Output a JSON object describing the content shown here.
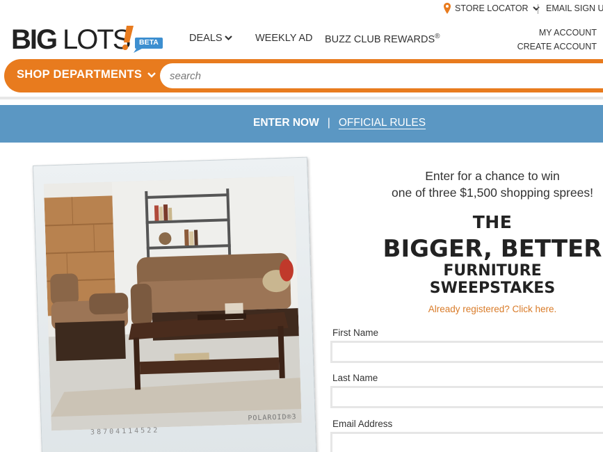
{
  "utility": {
    "store_locator": "STORE LOCATOR",
    "email_signup": "EMAIL SIGN UP"
  },
  "brand": {
    "logo_text": "BIGLOTS!",
    "beta_badge": "BETA",
    "colors": {
      "orange": "#e87b1e",
      "blue": "#5b97c3",
      "text": "#333333",
      "link_orange": "#d97b28"
    }
  },
  "nav": {
    "deals": "DEALS",
    "weekly_ad": "WEEKLY AD",
    "buzz_club": "BUZZ CLUB REWARDS",
    "buzz_reg": "®"
  },
  "account": {
    "my_account": "MY ACCOUNT",
    "create_account": "CREATE ACCOUNT"
  },
  "shop": {
    "departments_label": "SHOP DEPARTMENTS",
    "search_placeholder": "search"
  },
  "band": {
    "enter_now": "ENTER NOW",
    "separator": "|",
    "official_rules": "OFFICIAL RULES"
  },
  "photo": {
    "polaroid_label": "POLAROID®3",
    "polaroid_number": "38704114522"
  },
  "promo": {
    "line1": "Enter for a chance to win",
    "line2": "one of three $1,500 shopping sprees!",
    "title_the": "THE",
    "title_main": "BIGGER, BETTER",
    "title_sub": "FURNITURE SWEEPSTAKES",
    "already_registered": "Already registered? Click here."
  },
  "form": {
    "first_name_label": "First Name",
    "first_name_value": "",
    "last_name_label": "Last Name",
    "last_name_value": "",
    "email_label": "Email Address",
    "email_value": ""
  }
}
